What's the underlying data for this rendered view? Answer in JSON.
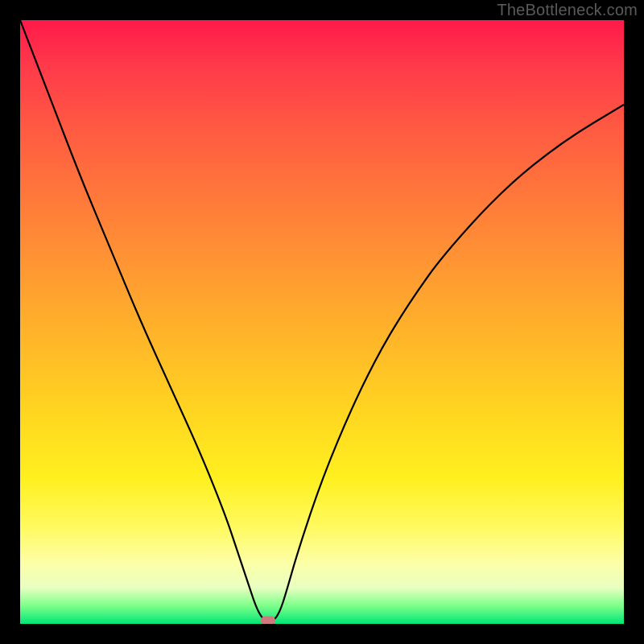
{
  "watermark": "TheBottleneck.com",
  "chart_data": {
    "type": "line",
    "title": "",
    "xlabel": "",
    "ylabel": "",
    "xlim": [
      0,
      100
    ],
    "ylim": [
      0,
      100
    ],
    "grid": false,
    "series": [
      {
        "name": "bottleneck-curve",
        "x": [
          0,
          5,
          10,
          15,
          20,
          25,
          30,
          34,
          36,
          38,
          39,
          40,
          41,
          42,
          43,
          44,
          46,
          50,
          55,
          60,
          65,
          70,
          80,
          90,
          100
        ],
        "values": [
          100,
          87,
          74,
          62,
          50,
          39,
          28,
          18,
          12,
          6,
          3,
          1,
          0.5,
          0.5,
          2,
          5,
          12,
          24,
          36,
          46,
          54,
          61,
          72,
          80,
          86
        ]
      }
    ],
    "marker": {
      "x": 41,
      "y": 0.5
    },
    "gradient_stops": [
      {
        "pos": 0,
        "color": "#ff1a4a"
      },
      {
        "pos": 50,
        "color": "#ffb928"
      },
      {
        "pos": 85,
        "color": "#fff020"
      },
      {
        "pos": 100,
        "color": "#00e676"
      }
    ]
  }
}
